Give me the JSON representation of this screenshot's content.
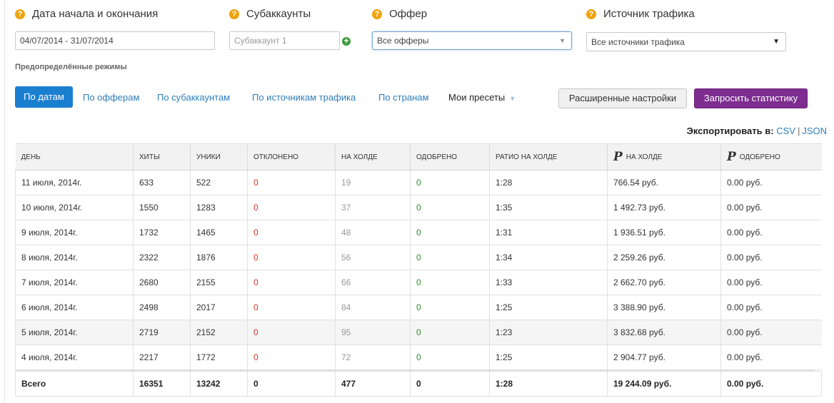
{
  "filters": {
    "date_range": {
      "label": "Дата начала и окончания",
      "value": "04/07/2014 - 31/07/2014"
    },
    "subaccounts": {
      "label": "Субаккаунты",
      "placeholder": "Субаккаунт 1"
    },
    "offer": {
      "label": "Оффер",
      "selected": "Все офферы"
    },
    "traffic_source": {
      "label": "Источник трафика",
      "selected": "Все источники трафика"
    },
    "help_glyph": "?",
    "add_glyph": "+"
  },
  "presets": {
    "label": "Предопределённые режимы",
    "tabs": [
      "По датам",
      "По офферам",
      "По субаккаунтам",
      "По источникам трафика",
      "По странам"
    ],
    "active_tab": "По датам",
    "my_presets": "Мои пресеты"
  },
  "buttons": {
    "advanced": "Расширенные настройки",
    "request": "Запросить статистику"
  },
  "export": {
    "label": "Экспортировать в:",
    "csv": "CSV",
    "sep": "|",
    "json": "JSON"
  },
  "table": {
    "currency_glyph": "Р",
    "columns": [
      "День",
      "Хиты",
      "Уники",
      "Отклонено",
      "На холде",
      "Одобрено",
      "Ратио на холде",
      "На холде",
      "Одобрено"
    ],
    "rows": [
      [
        "11 июля, 2014г.",
        "633",
        "522",
        "0",
        "19",
        "0",
        "1:28",
        "766.54 руб.",
        "0.00 руб."
      ],
      [
        "10 июля, 2014г.",
        "1550",
        "1283",
        "0",
        "37",
        "0",
        "1:35",
        "1 492.73 руб.",
        "0.00 руб."
      ],
      [
        "9 июля, 2014г.",
        "1732",
        "1465",
        "0",
        "48",
        "0",
        "1:31",
        "1 936.51 руб.",
        "0.00 руб."
      ],
      [
        "8 июля, 2014г.",
        "2322",
        "1876",
        "0",
        "56",
        "0",
        "1:34",
        "2 259.26 руб.",
        "0.00 руб."
      ],
      [
        "7 июля, 2014г.",
        "2680",
        "2155",
        "0",
        "66",
        "0",
        "1:33",
        "2 662.70 руб.",
        "0.00 руб."
      ],
      [
        "6 июля, 2014г.",
        "2498",
        "2017",
        "0",
        "84",
        "0",
        "1:25",
        "3 388.90 руб.",
        "0.00 руб."
      ],
      [
        "5 июля, 2014г.",
        "2719",
        "2152",
        "0",
        "95",
        "0",
        "1:23",
        "3 832.68 руб.",
        "0.00 руб."
      ],
      [
        "4 июля, 2014г.",
        "2217",
        "1772",
        "0",
        "72",
        "0",
        "1:25",
        "2 904.77 руб.",
        "0.00 руб."
      ]
    ],
    "totals": [
      "Всего",
      "16351",
      "13242",
      "0",
      "477",
      "0",
      "1:28",
      "19 244.09 руб.",
      "0.00 руб."
    ]
  },
  "colors": {
    "accent": "#1b7fd0",
    "link": "#2f7db9",
    "request_button": "#7d2d8f",
    "help_icon": "#f0a30a",
    "rejected": "#d9342a",
    "on_hold": "#999999",
    "approved": "#2f8e2f"
  }
}
